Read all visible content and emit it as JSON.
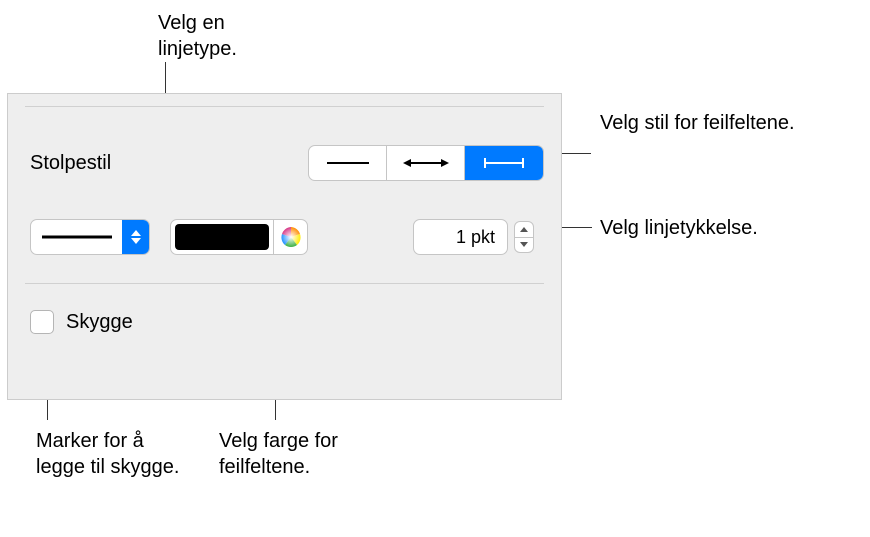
{
  "callouts": {
    "linetype": "Velg en linjetype.",
    "errorbar_style": "Velg stil for feilfeltene.",
    "line_thickness": "Velg linjetykkelse.",
    "shadow": "Marker for å legge til skygge.",
    "errorbar_color": "Velg farge for feilfeltene."
  },
  "panel": {
    "section_label": "Stolpestil",
    "thickness_value": "1 pkt",
    "shadow_label": "Skygge",
    "color_value": "#000000"
  }
}
